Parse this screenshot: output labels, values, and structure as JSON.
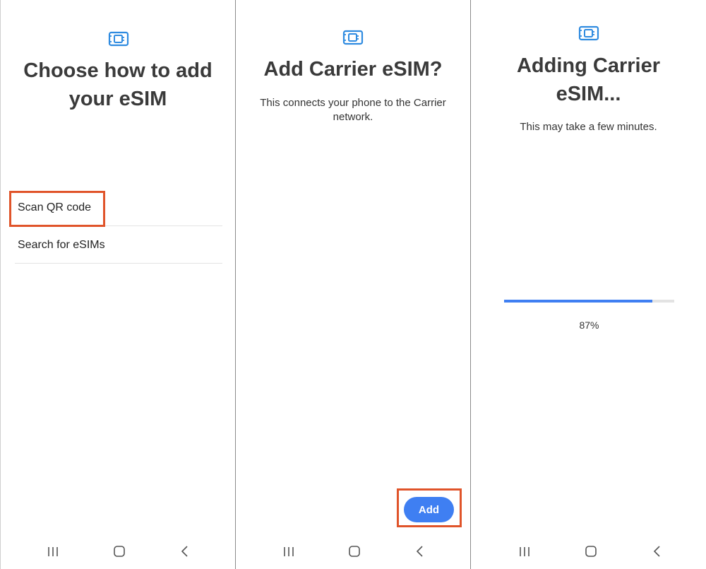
{
  "colors": {
    "accent": "#3f7ff2",
    "highlight": "#e0542a",
    "icon": "#2f8be0"
  },
  "screens": [
    {
      "icon": "esim-card-icon",
      "title_line1": "Choose how to add",
      "title_line2": "your eSIM",
      "options": [
        {
          "label": "Scan QR code",
          "highlighted": true
        },
        {
          "label": "Search for eSIMs",
          "highlighted": false
        }
      ]
    },
    {
      "icon": "esim-card-icon",
      "title": "Add Carrier eSIM?",
      "subtitle": "This connects your phone to the Carrier network.",
      "add_button_label": "Add"
    },
    {
      "icon": "esim-card-icon",
      "title_line1": "Adding Carrier",
      "title_line2": "eSIM...",
      "subtitle": "This may take a few minutes.",
      "progress_fraction": 0.87,
      "progress_label": "87%"
    }
  ],
  "navbar": {
    "icons": [
      "recent-apps-icon",
      "home-icon",
      "back-icon"
    ]
  }
}
